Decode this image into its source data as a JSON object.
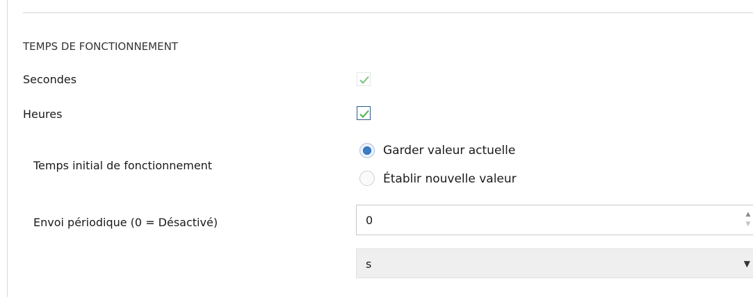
{
  "section": {
    "title": "TEMPS DE FONCTIONNEMENT"
  },
  "seconds": {
    "label": "Secondes",
    "checked": true,
    "enabled": false
  },
  "hours": {
    "label": "Heures",
    "checked": true,
    "enabled": true
  },
  "initial_time": {
    "label": "Temps initial de fonctionnement",
    "options": [
      {
        "label": "Garder valeur actuelle",
        "selected": true
      },
      {
        "label": "Établir nouvelle valeur",
        "selected": false
      }
    ]
  },
  "periodic": {
    "label": "Envoi périodique (0 = Désactivé)",
    "value": "0",
    "unit": "s"
  },
  "colors": {
    "check_green": "#4caf50",
    "radio_blue": "#3a7dc9",
    "focus_border": "#2a5c8a"
  }
}
